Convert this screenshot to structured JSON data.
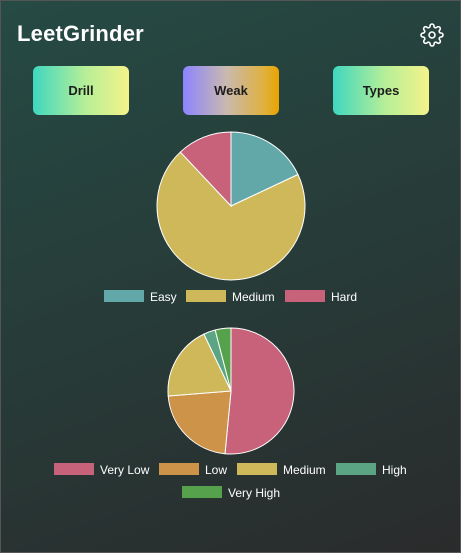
{
  "app": {
    "title": "LeetGrinder"
  },
  "icons": {
    "settings": "gear-icon"
  },
  "toolbar": {
    "drill_label": "Drill",
    "weak_label": "Weak",
    "types_label": "Types"
  },
  "chart_data": [
    {
      "type": "pie",
      "categories": [
        "Easy",
        "Medium",
        "Hard"
      ],
      "values": [
        18,
        70,
        12
      ],
      "colors": [
        "#62a8a8",
        "#cfb85a",
        "#c8627a"
      ],
      "legend": "bottom"
    },
    {
      "type": "pie",
      "categories": [
        "Very Low",
        "Low",
        "Medium",
        "High",
        "Very High"
      ],
      "values": [
        51,
        22,
        19,
        3,
        4
      ],
      "colors": [
        "#c8627a",
        "#cc9349",
        "#cfb85a",
        "#5ba585",
        "#56a14b"
      ],
      "legend": "bottom"
    }
  ]
}
